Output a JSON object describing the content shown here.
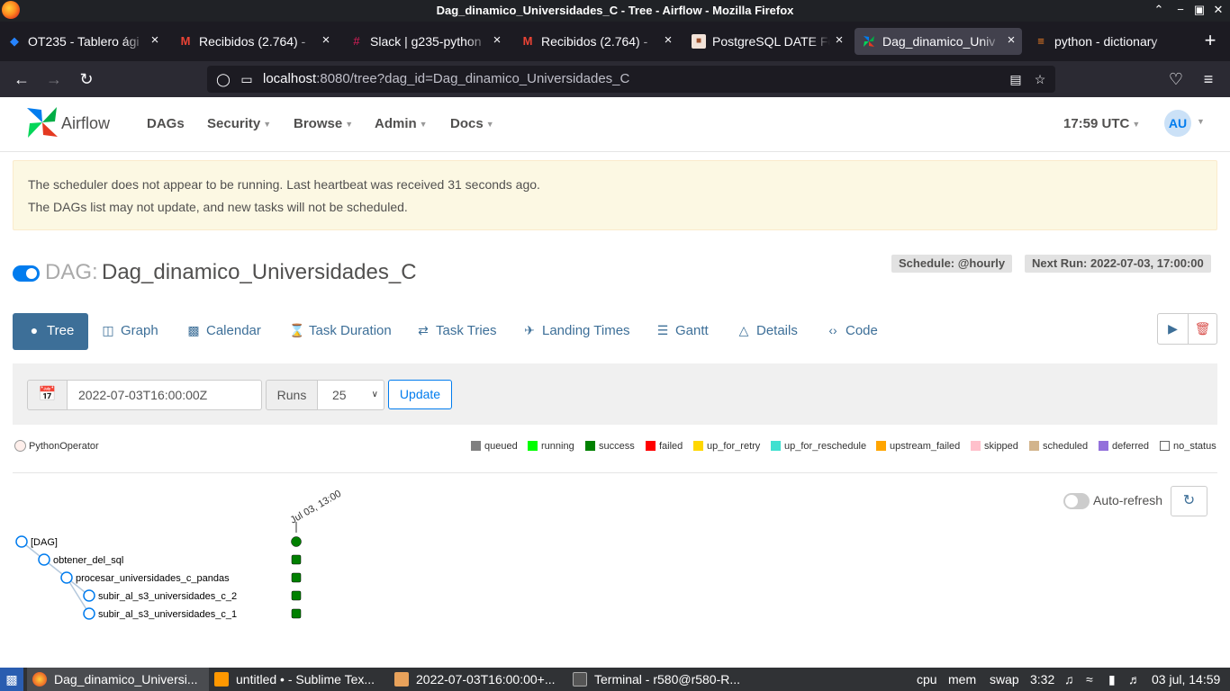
{
  "window": {
    "title": "Dag_dinamico_Universidades_C - Tree - Airflow - Mozilla Firefox",
    "controls": [
      "minimize",
      "maximize",
      "close"
    ]
  },
  "tabs": [
    {
      "label": "OT235 - Tablero ági",
      "icon": "jira-icon",
      "active": false
    },
    {
      "label": "Recibidos (2.764) - ",
      "icon": "gmail-icon",
      "active": false
    },
    {
      "label": "Slack | g235-python",
      "icon": "slack-icon",
      "active": false
    },
    {
      "label": "Recibidos (2.764) - ",
      "icon": "gmail-icon",
      "active": false
    },
    {
      "label": "PostgreSQL DATE Fo",
      "icon": "postgres-icon",
      "active": false
    },
    {
      "label": "Dag_dinamico_Univ",
      "icon": "airflow-icon",
      "active": true
    },
    {
      "label": "python - dictionary",
      "icon": "stackoverflow-icon",
      "active": false
    }
  ],
  "urlbar": {
    "host": "localhost",
    "rest": ":8080/tree?dag_id=Dag_dinamico_Universidades_C"
  },
  "airflow_nav": {
    "brand": "Airflow",
    "menus": [
      "DAGs",
      "Security",
      "Browse",
      "Admin",
      "Docs"
    ],
    "clock": "17:59 UTC",
    "avatar": "AU"
  },
  "alert": {
    "line1": "The scheduler does not appear to be running. Last heartbeat was received 31 seconds ago.",
    "line2": "The DAGs list may not update, and new tasks will not be scheduled."
  },
  "dag": {
    "prefix": "DAG:",
    "name": "Dag_dinamico_Universidades_C",
    "schedule": "Schedule: @hourly",
    "next_run": "Next Run: 2022-07-03, 17:00:00",
    "paused": false
  },
  "view_tabs": [
    {
      "label": "Tree",
      "icon": "tree-icon",
      "active": true
    },
    {
      "label": "Graph",
      "icon": "graph-icon",
      "active": false
    },
    {
      "label": "Calendar",
      "icon": "calendar-icon",
      "active": false
    },
    {
      "label": "Task Duration",
      "icon": "hourglass-icon",
      "active": false
    },
    {
      "label": "Task Tries",
      "icon": "retry-icon",
      "active": false
    },
    {
      "label": "Landing Times",
      "icon": "plane-landing-icon",
      "active": false
    },
    {
      "label": "Gantt",
      "icon": "gantt-icon",
      "active": false
    },
    {
      "label": "Details",
      "icon": "details-icon",
      "active": false
    },
    {
      "label": "Code",
      "icon": "code-icon",
      "active": false
    }
  ],
  "filter": {
    "base_date": "2022-07-03T16:00:00Z",
    "runs_label": "Runs",
    "runs_value": "25",
    "update_label": "Update"
  },
  "operator_legend": {
    "label": "PythonOperator",
    "color": "#ffefeb"
  },
  "state_legend": [
    {
      "label": "queued",
      "color": "#808080"
    },
    {
      "label": "running",
      "color": "#00ff00"
    },
    {
      "label": "success",
      "color": "#008000"
    },
    {
      "label": "failed",
      "color": "#ff0000"
    },
    {
      "label": "up_for_retry",
      "color": "#ffd700"
    },
    {
      "label": "up_for_reschedule",
      "color": "#40e0d0"
    },
    {
      "label": "upstream_failed",
      "color": "#ffa500"
    },
    {
      "label": "skipped",
      "color": "#ffc0cb"
    },
    {
      "label": "scheduled",
      "color": "#d2b48c"
    },
    {
      "label": "deferred",
      "color": "#9370db"
    },
    {
      "label": "no_status",
      "color": "#ffffff"
    }
  ],
  "auto_refresh": {
    "label": "Auto-refresh",
    "enabled": false
  },
  "tree": {
    "run_label": "Jul 03, 13:00",
    "nodes": [
      {
        "label": "[DAG]",
        "depth": 0,
        "state": "success"
      },
      {
        "label": "obtener_del_sql",
        "depth": 1,
        "state": "success"
      },
      {
        "label": "procesar_universidades_c_pandas",
        "depth": 2,
        "state": "success"
      },
      {
        "label": "subir_al_s3_universidades_c_2",
        "depth": 3,
        "state": "success"
      },
      {
        "label": "subir_al_s3_universidades_c_1",
        "depth": 3,
        "state": "success"
      }
    ]
  },
  "taskbar": {
    "items": [
      {
        "label": "Dag_dinamico_Universi...",
        "icon": "firefox-icon",
        "active": true
      },
      {
        "label": "untitled • - Sublime Tex...",
        "icon": "sublime-icon",
        "active": false
      },
      {
        "label": "2022-07-03T16:00:00+...",
        "icon": "folder-icon",
        "active": false
      },
      {
        "label": "Terminal - r580@r580-R...",
        "icon": "terminal-icon",
        "active": false
      }
    ],
    "cpu": "cpu",
    "mem": "mem",
    "swap": "swap",
    "time_small": "3:32",
    "datetime": "03 jul, 14:59"
  }
}
